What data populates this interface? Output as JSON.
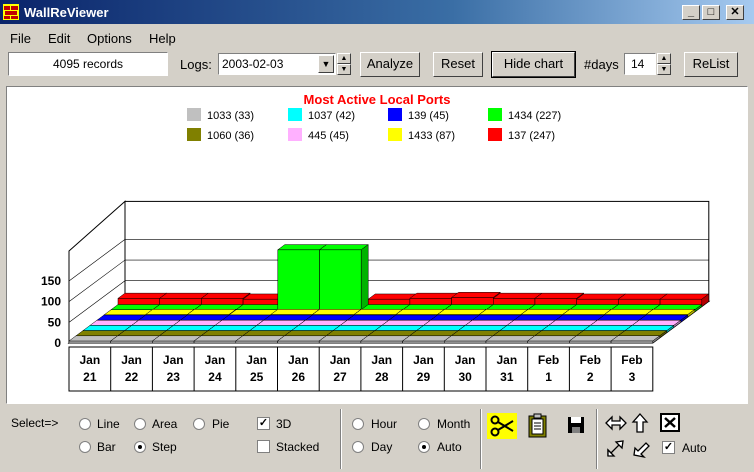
{
  "window": {
    "title": "WallReViewer",
    "minimize": "_",
    "maximize": "□",
    "close": "✕"
  },
  "menu": [
    {
      "label": "File"
    },
    {
      "label": "Edit"
    },
    {
      "label": "Options"
    },
    {
      "label": "Help"
    }
  ],
  "toolbar": {
    "records": "4095 records",
    "logs_label": "Logs:",
    "logs_value": "2003-02-03",
    "analyze": "Analyze",
    "reset": "Reset",
    "hide_chart": "Hide chart",
    "days_label": "#days",
    "days_value": "14",
    "relist": "ReList"
  },
  "chart_data": {
    "type": "bar",
    "title": "Most Active Local Ports",
    "categories": [
      "Jan 21",
      "Jan 22",
      "Jan 23",
      "Jan 24",
      "Jan 25",
      "Jan 26",
      "Jan 27",
      "Jan 28",
      "Jan 29",
      "Jan 30",
      "Jan 31",
      "Feb 1",
      "Feb 2",
      "Feb 3"
    ],
    "ylim": [
      0,
      150
    ],
    "yticks": [
      "0",
      "50",
      "100",
      "150"
    ],
    "legend": [
      {
        "label": "1033 (33)",
        "color": "#c0c0c0"
      },
      {
        "label": "1037 (42)",
        "color": "#00ffff"
      },
      {
        "label": "139 (45)",
        "color": "#0000ff"
      },
      {
        "label": "1434 (227)",
        "color": "#00ff00"
      },
      {
        "label": "1060 (36)",
        "color": "#808000"
      },
      {
        "label": "445 (45)",
        "color": "#ffb0ff"
      },
      {
        "label": "1433 (87)",
        "color": "#ffff00"
      },
      {
        "label": "137 (247)",
        "color": "#ff0000"
      }
    ],
    "series": [
      {
        "name": "1033 (33)",
        "color": "#c0c0c0",
        "values": [
          3,
          3,
          3,
          3,
          2,
          3,
          2,
          2,
          2,
          2,
          3,
          2,
          2,
          5
        ]
      },
      {
        "name": "1060 (36)",
        "color": "#808000",
        "values": [
          3,
          3,
          3,
          3,
          3,
          3,
          2,
          3,
          2,
          2,
          2,
          3,
          2,
          2
        ]
      },
      {
        "name": "1037 (42)",
        "color": "#00ffff",
        "values": [
          3,
          3,
          3,
          3,
          3,
          3,
          3,
          3,
          3,
          3,
          3,
          3,
          3,
          3
        ]
      },
      {
        "name": "445 (45)",
        "color": "#ffb0ff",
        "values": [
          3,
          3,
          3,
          5,
          3,
          3,
          3,
          3,
          3,
          3,
          4,
          3,
          3,
          3
        ]
      },
      {
        "name": "139 (45)",
        "color": "#0000ff",
        "values": [
          3,
          3,
          3,
          3,
          4,
          3,
          3,
          3,
          3,
          3,
          3,
          3,
          3,
          3
        ]
      },
      {
        "name": "1433 (87)",
        "color": "#ffff00",
        "values": [
          5,
          6,
          6,
          5,
          6,
          6,
          6,
          6,
          6,
          6,
          6,
          6,
          6,
          6
        ]
      },
      {
        "name": "1434 (227)",
        "color": "#00ff00",
        "values": [
          5,
          5,
          5,
          5,
          150,
          150,
          5,
          5,
          5,
          5,
          5,
          5,
          5,
          4
        ]
      },
      {
        "name": "137 (247)",
        "color": "#ff0000",
        "values": [
          20,
          20,
          20,
          18,
          8,
          6,
          18,
          20,
          22,
          20,
          20,
          18,
          18,
          18
        ]
      }
    ]
  },
  "controls": {
    "select_label": "Select=>",
    "chart_types": [
      {
        "label": "Line",
        "checked": false
      },
      {
        "label": "Area",
        "checked": false
      },
      {
        "label": "Pie",
        "checked": false
      },
      {
        "label": "Bar",
        "checked": false
      },
      {
        "label": "Step",
        "checked": true
      }
    ],
    "three_d": {
      "label": "3D",
      "checked": true
    },
    "stacked": {
      "label": "Stacked",
      "checked": false
    },
    "periods": [
      {
        "label": "Hour",
        "checked": false
      },
      {
        "label": "Month",
        "checked": false
      },
      {
        "label": "Day",
        "checked": false
      },
      {
        "label": "Auto",
        "checked": true
      }
    ],
    "auto_check": {
      "label": "Auto",
      "checked": true
    }
  }
}
